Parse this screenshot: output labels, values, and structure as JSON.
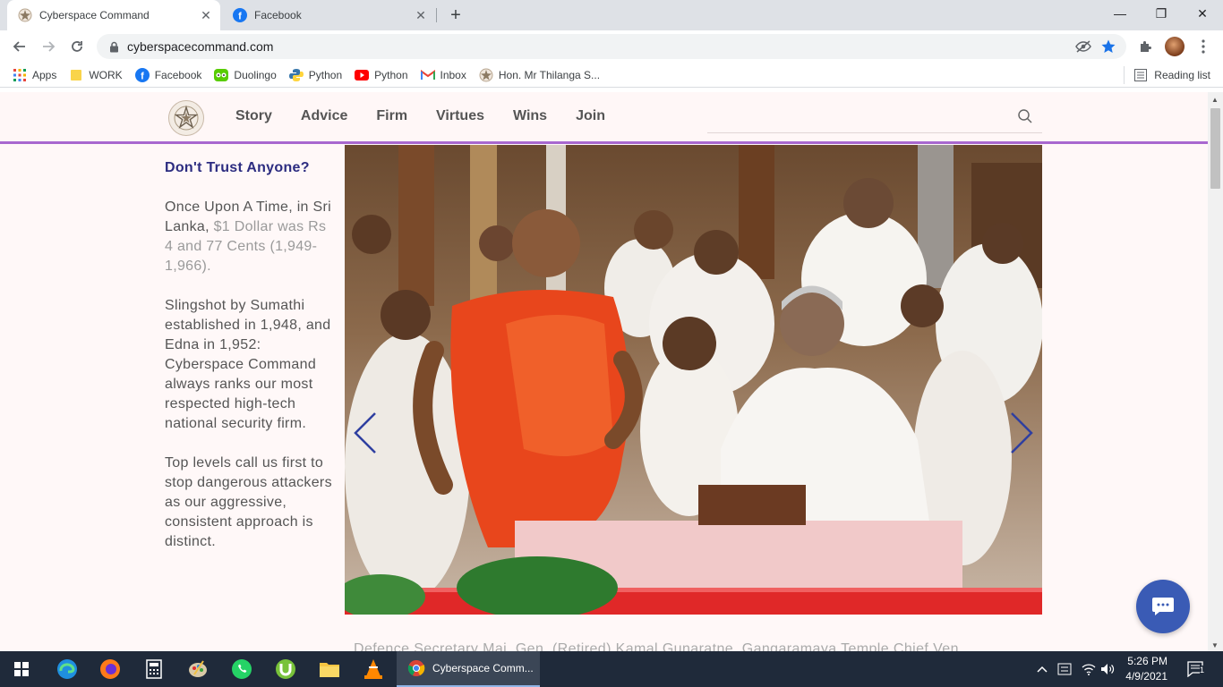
{
  "browser": {
    "tabs": [
      {
        "title": "Cyberspace Command",
        "active": true
      },
      {
        "title": "Facebook",
        "active": false
      }
    ],
    "url": "cyberspacecommand.com",
    "bookmarks": [
      {
        "label": "Apps",
        "icon": "apps-grid-icon"
      },
      {
        "label": "WORK",
        "icon": "folder-icon"
      },
      {
        "label": "Facebook",
        "icon": "facebook-icon"
      },
      {
        "label": "Duolingo",
        "icon": "duolingo-icon"
      },
      {
        "label": "Python",
        "icon": "python-icon"
      },
      {
        "label": "Python",
        "icon": "youtube-icon"
      },
      {
        "label": "Inbox",
        "icon": "gmail-icon"
      },
      {
        "label": "Hon. Mr Thilanga S...",
        "icon": "star-badge-icon"
      }
    ],
    "reading_list": "Reading list"
  },
  "site": {
    "nav": [
      "Story",
      "Advice",
      "Firm",
      "Virtues",
      "Wins",
      "Join"
    ],
    "search_placeholder": ""
  },
  "article": {
    "heading": "Don't Trust Anyone?",
    "p1_a": "Once Upon A Time, in Sri Lanka,",
    "p1_b": "$1 Dollar was Rs 4 and 77 Cents (1,949-1,966).",
    "p2": "Slingshot by Sumathi established in 1,948, and Edna in 1,952: Cyberspace Command always ranks our most respected high-tech national security firm.",
    "p3": "Top levels call us first to stop dangerous attackers as our aggressive, consistent approach is distinct.",
    "caption": "Defence Secretary Maj. Gen. (Retired) Kamal Gunaratne, Gangaramaya Temple Chief Ven."
  },
  "taskbar": {
    "active_app": "Cyberspace Comm...",
    "time": "5:26 PM",
    "date": "4/9/2021",
    "notifications": "1"
  },
  "colors": {
    "accent_purple": "#a868d0",
    "heading_navy": "#2c2c80",
    "chat_blue": "#3a5bb5"
  }
}
